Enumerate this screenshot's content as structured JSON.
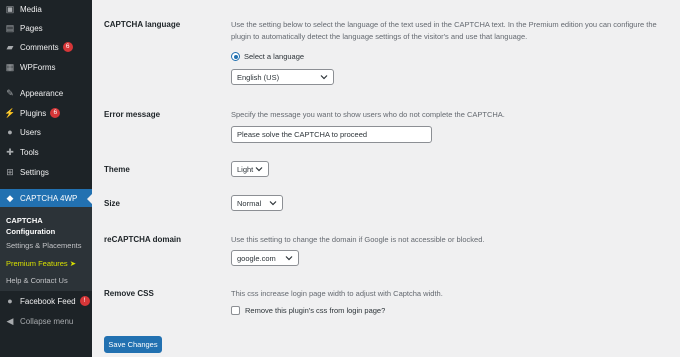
{
  "sidebar": {
    "items": [
      {
        "label": "Media",
        "icon": "media-icon"
      },
      {
        "label": "Pages",
        "icon": "pages-icon"
      },
      {
        "label": "Comments",
        "icon": "comments-icon",
        "badge": "6"
      },
      {
        "label": "WPForms",
        "icon": "wpforms-icon"
      },
      {
        "label": "Appearance",
        "icon": "appearance-icon"
      },
      {
        "label": "Plugins",
        "icon": "plugins-icon",
        "badge": "6"
      },
      {
        "label": "Users",
        "icon": "users-icon"
      },
      {
        "label": "Tools",
        "icon": "tools-icon"
      },
      {
        "label": "Settings",
        "icon": "settings-icon"
      },
      {
        "label": "CAPTCHA 4WP",
        "icon": "captcha-icon"
      }
    ],
    "submenu": {
      "configuration": "CAPTCHA Configuration",
      "settings_placements": "Settings & Placements",
      "premium_features": "Premium Features ➤",
      "help_contact": "Help & Contact Us"
    },
    "facebook_feed": {
      "label": "Facebook Feed",
      "badge": "!"
    },
    "collapse": "Collapse menu"
  },
  "form": {
    "captcha_language": {
      "label": "CAPTCHA language",
      "description": "Use the setting below to select the language of the text used in the CAPTCHA text. In the Premium edition you can configure the plugin to automatically detect the language settings of the visitor's and use that language.",
      "radio_label": "Select a language",
      "selected": "English (US)"
    },
    "error_message": {
      "label": "Error message",
      "description": "Specify the message you want to show users who do not complete the CAPTCHA.",
      "value": "Please solve the CAPTCHA to proceed"
    },
    "theme": {
      "label": "Theme",
      "selected": "Light"
    },
    "size": {
      "label": "Size",
      "selected": "Normal"
    },
    "recaptcha_domain": {
      "label": "reCAPTCHA domain",
      "description": "Use this setting to change the domain if Google is not accessible or blocked.",
      "selected": "google.com"
    },
    "remove_css": {
      "label": "Remove CSS",
      "description": "This css increase login page width to adjust with Captcha width.",
      "checkbox_label": "Remove this plugin's css from login page?"
    },
    "save_label": "Save Changes"
  },
  "colors": {
    "accent": "#2271b1",
    "sidebar": "#1d2327",
    "badge": "#d63638",
    "premium": "#d8e000"
  }
}
